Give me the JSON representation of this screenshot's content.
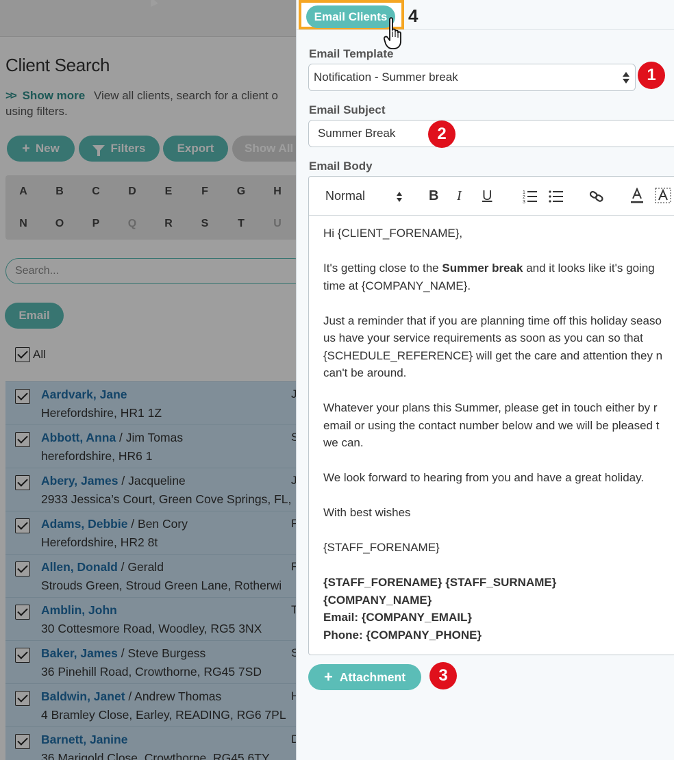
{
  "left": {
    "page_title": "Client Search",
    "show_more": "Show more",
    "description_1": "View all clients, search for a client o",
    "description_2": "using filters.",
    "buttons": {
      "new": "New",
      "filters": "Filters",
      "export": "Export",
      "show_all": "Show All"
    },
    "alphabet_row1": [
      "A",
      "B",
      "C",
      "D",
      "E",
      "F",
      "G",
      "H"
    ],
    "alphabet_row2": [
      "N",
      "O",
      "P",
      "Q",
      "R",
      "S",
      "T",
      "U"
    ],
    "search_placeholder": "Search...",
    "email_button": "Email",
    "all_label": "All",
    "clients": [
      {
        "name": "Aardvark, Jane",
        "partner": "",
        "address": "Herefordshire, HR1 1Z",
        "extra": "J"
      },
      {
        "name": "Abbott, Anna",
        "partner": " / Jim Tomas",
        "address": "herefordshire, HR6 1",
        "extra": "S"
      },
      {
        "name": "Abery, James",
        "partner": " / Jacqueline",
        "address": "2933 Jessica’s Court, Green Cove Springs, FL,",
        "extra": "J"
      },
      {
        "name": "Adams, Debbie",
        "partner": " / Ben Cory",
        "address": "Herefordshire, HR2 8t",
        "extra": "F"
      },
      {
        "name": "Allen, Donald",
        "partner": " / Gerald",
        "address": "Strouds Green, Stroud Green Lane, Rotherwi",
        "extra": "F"
      },
      {
        "name": "Amblin, John",
        "partner": "",
        "address": "30 Cottesmore Road, Woodley, RG5 3NX",
        "extra": "T"
      },
      {
        "name": "Baker, James",
        "partner": " / Steve Burgess",
        "address": "36 Pinehill Road, Crowthorne, RG45 7SD",
        "extra": "S"
      },
      {
        "name": "Baldwin, Janet",
        "partner": " / Andrew Thomas",
        "address": "4 Bramley Close, Earley, READING, RG6 7PL",
        "extra": "H"
      },
      {
        "name": "Barnett, Janine",
        "partner": "",
        "address": "36 Marigold Close, Crowthorne, RG45 6TY",
        "extra": "D"
      }
    ]
  },
  "drawer": {
    "email_clients_button": "Email Clients",
    "email_template_label": "Email Template",
    "email_template_value": "Notification - Summer break",
    "email_subject_label": "Email Subject",
    "email_subject_value": "Summer Break",
    "email_body_label": "Email Body",
    "toolbar": {
      "format": "Normal",
      "bold": "B",
      "italic": "I",
      "underline": "U"
    },
    "body": {
      "greeting": "Hi {CLIENT_FORENAME},",
      "p1_a": "It's getting close to the ",
      "p1_bold": "Summer break",
      "p1_b": " and it looks like it's going",
      "p1_c": "time at {COMPANY_NAME}.",
      "p2_a": "Just a reminder that if you are planning time off this holiday seaso",
      "p2_b": "us have your service requirements as soon as you can so that",
      "p2_c": "{SCHEDULE_REFERENCE} will get the care and attention they n",
      "p2_d": "can't be around.",
      "p3_a": "Whatever your plans this Summer, please get in touch either by r",
      "p3_b": "email or using the contact number below and we will be pleased t",
      "p3_c": "we can.",
      "p4": "We look forward to hearing from you and have a great holiday.",
      "p5": "With best wishes",
      "p6": "{STAFF_FORENAME}",
      "sig1": "{STAFF_FORENAME} {STAFF_SURNAME}",
      "sig2": "{COMPANY_NAME}",
      "sig3": "Email: {COMPANY_EMAIL}",
      "sig4": "Phone: {COMPANY_PHONE}"
    },
    "attachment_button": "Attachment"
  },
  "annotations": {
    "step1": "1",
    "step2": "2",
    "step3": "3",
    "step4": "4"
  },
  "colors": {
    "accent_teal": "#5bbdb7",
    "highlight_orange": "#f5a623",
    "badge_red": "#e0101c",
    "link_blue": "#1f6ea8"
  }
}
